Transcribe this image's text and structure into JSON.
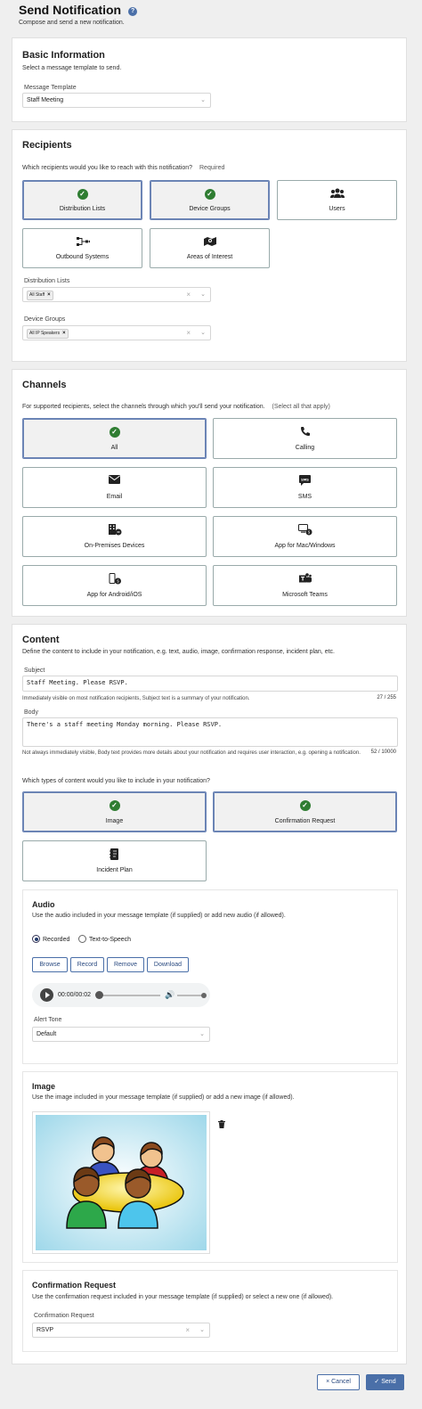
{
  "header": {
    "title": "Send Notification",
    "help_icon": "?",
    "subtitle": "Compose and send a new notification."
  },
  "basic": {
    "title": "Basic Information",
    "desc": "Select a message template to send.",
    "template_label": "Message Template",
    "template_value": "Staff Meeting"
  },
  "recipients": {
    "title": "Recipients",
    "question": "Which recipients would you like to reach with this notification?",
    "required": "Required",
    "options": [
      {
        "label": "Distribution Lists",
        "selected": true,
        "icon": "check-icon"
      },
      {
        "label": "Device Groups",
        "selected": true,
        "icon": "check-icon"
      },
      {
        "label": "Users",
        "selected": false,
        "icon": "users-icon"
      },
      {
        "label": "Outbound Systems",
        "selected": false,
        "icon": "outbound-systems-icon"
      },
      {
        "label": "Areas of Interest",
        "selected": false,
        "icon": "map-pin-icon"
      }
    ],
    "dl_label": "Distribution Lists",
    "dl_tag": "All Staff",
    "dg_label": "Device Groups",
    "dg_tag": "All IP Speakers"
  },
  "channels": {
    "title": "Channels",
    "question": "For supported recipients, select the channels through which you'll send your notification.",
    "hint": "(Select all that apply)",
    "options": [
      {
        "label": "All",
        "selected": true,
        "icon": "check-icon"
      },
      {
        "label": "Calling",
        "selected": false,
        "icon": "phone-icon"
      },
      {
        "label": "Email",
        "selected": false,
        "icon": "envelope-icon"
      },
      {
        "label": "SMS",
        "selected": false,
        "icon": "sms-icon"
      },
      {
        "label": "On-Premises Devices",
        "selected": false,
        "icon": "building-icon"
      },
      {
        "label": "App for Mac/Windows",
        "selected": false,
        "icon": "desktop-app-icon"
      },
      {
        "label": "App for Android/iOS",
        "selected": false,
        "icon": "mobile-app-icon"
      },
      {
        "label": "Microsoft Teams",
        "selected": false,
        "icon": "teams-icon"
      }
    ]
  },
  "content": {
    "title": "Content",
    "desc": "Define the content to include in your notification, e.g. text, audio, image, confirmation response, incident plan, etc.",
    "subject_label": "Subject",
    "subject_value": "Staff Meeting. Please RSVP.",
    "subject_help": "Immediately visible on most notification recipients, Subject text is a summary of your notification.",
    "subject_count": "27 / 255",
    "body_label": "Body",
    "body_value": "There's a staff meeting Monday morning. Please RSVP.",
    "body_help": "Not always immediately visible, Body text provides more details about your notification and requires user interaction, e.g. opening a notification.",
    "body_count": "52 / 10000",
    "types_question": "Which types of content would you like to include in your notification?",
    "types": [
      {
        "label": "Image",
        "selected": true,
        "icon": "check-icon"
      },
      {
        "label": "Confirmation Request",
        "selected": true,
        "icon": "check-icon"
      },
      {
        "label": "Incident Plan",
        "selected": false,
        "icon": "incident-plan-icon"
      }
    ]
  },
  "audio": {
    "title": "Audio",
    "desc": "Use the audio included in your message template (if supplied) or add new audio (if allowed).",
    "radio_recorded": "Recorded",
    "radio_tts": "Text-to-Speech",
    "btn_browse": "Browse",
    "btn_record": "Record",
    "btn_remove": "Remove",
    "btn_download": "Download",
    "time": "00:00/00:02",
    "alert_label": "Alert Tone",
    "alert_value": "Default"
  },
  "image": {
    "title": "Image",
    "desc": "Use the image included in your message template (if supplied) or add a new image (if allowed)."
  },
  "confirmation": {
    "title": "Confirmation Request",
    "desc": "Use the confirmation request included in your message template (if supplied) or select a new one (if allowed).",
    "label": "Confirmation Request",
    "value": "RSVP"
  },
  "footer": {
    "cancel": "Cancel",
    "send": "Send"
  },
  "colors": {
    "accent": "#4a6fa8",
    "check": "#2f7d32",
    "send_bg": "#4a6fa8"
  }
}
